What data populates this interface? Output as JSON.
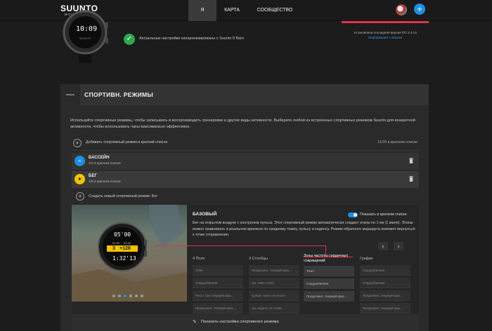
{
  "nav": {
    "logo": "SUUNTO",
    "logo_sub": "MOVESCOUNT",
    "tabs": [
      {
        "label": "Я",
        "active": true
      },
      {
        "label": "КАРТА",
        "active": false
      },
      {
        "label": "СООБЩЕСТВО",
        "active": false
      }
    ],
    "plus": "+"
  },
  "watch_top": {
    "time": "10:09"
  },
  "sync": {
    "text": "Актуальные настройки синхронизированы с Suunto 9 Baro"
  },
  "firmware": {
    "text": "Установлена последняя версия ПО 2.4.14",
    "link": "Информация о версии"
  },
  "panel": {
    "title": "СПОРТИВН. РЕЖИМЫ",
    "collapse": "—",
    "description": "Используйте спортивные режимы, чтобы записывать и воспроизводить тренировки и другие виды активности. Выберите любой из встроенных спортивных режимов Suunto для конкретной активности, чтобы использовать часы максимально эффективно.",
    "add_label": "Добавить спортивный режим в краткий список",
    "add_count": "11/20 в кратком списке",
    "modes": [
      {
        "name": "БАССЕЙН",
        "sub": "1/2 в кратком списке",
        "color": "#1e8fe0",
        "icon": "pool-icon"
      },
      {
        "name": "БЕГ",
        "sub": "1/5 в кратком списке",
        "color": "#f2c200",
        "icon": "run-icon"
      }
    ],
    "create_label": "Создать новый спортивный режим: Бег"
  },
  "detail": {
    "title": "БАЗОВЫЙ",
    "toggle_label": "Показать в кратком списке",
    "description": "Бег на открытом воздухе с контролем пульса. Этот спортивный режим автоматически создает этапы по 1 км (1 миля). Этапы можно сравнивать в реальном времени по среднему темпу, пульсу и каденсу. Режим обратного маршрута поможет вернуться к точке отправления.",
    "watch": {
      "top": "05'00",
      "left": "3",
      "mid": "+128",
      "time": "1:32'13",
      "small_a": "01:32",
      "small_b": "01:32"
    },
    "prev": "‹",
    "next": "›",
    "columns": [
      {
        "head": "4 Поля",
        "cells": [
          "Темп",
          "Сердцебиение",
          "Расст. при текущей фаз...",
          "Продолжит. текущей фаз..."
        ],
        "highlight": false
      },
      {
        "head": "3 Столбцы",
        "cells": [
          "Продолжит. текущей фаз...",
          "Ср. темп этапа",
          "Средн. пульс на этапе",
          "Ср. каденс на этапе"
        ],
        "highlight": false
      },
      {
        "head": "Зоны частоты сердечных сокращений",
        "cells": [
          "Темп",
          "Сердцебиение",
          "Продолжит. текущей фаз..."
        ],
        "highlight": true
      },
      {
        "head": "График",
        "cells": [
          "Сердцебиение",
          "Сердцебиение",
          "Продолжит. текущей фаз...",
          "Продолжит. текущей фаз..."
        ],
        "highlight": false
      }
    ],
    "footer_label": "Показать настройки спортивного режима"
  },
  "colors": {
    "accent": "#1e8fe0",
    "success": "#2fa84f",
    "danger": "#e0344a",
    "run": "#f2c200"
  }
}
